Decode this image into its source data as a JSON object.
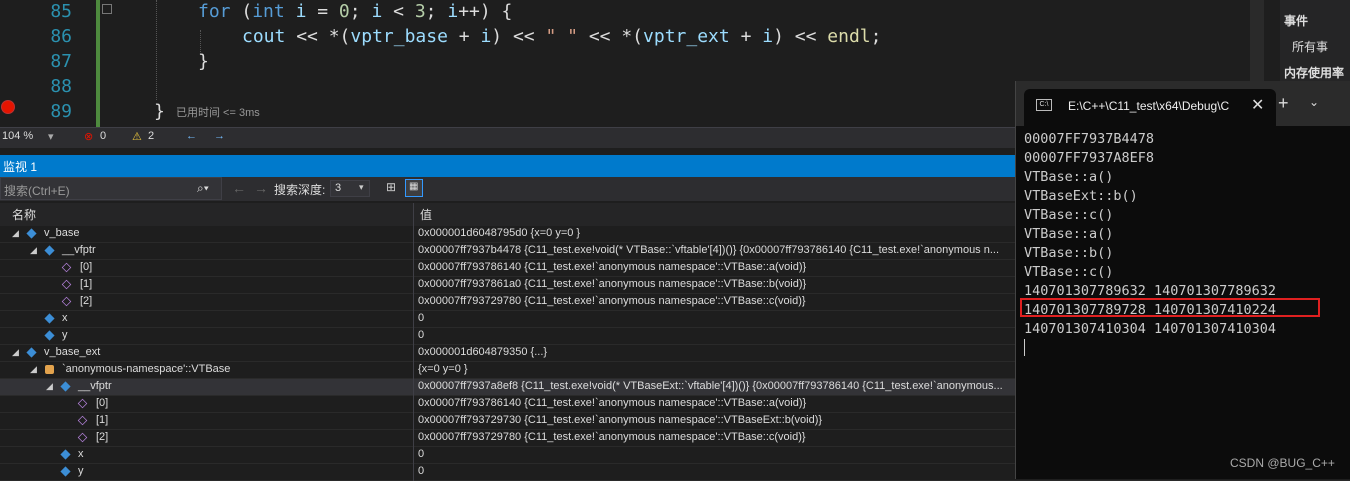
{
  "editor": {
    "line_numbers": [
      "85",
      "86",
      "87",
      "88",
      "89"
    ],
    "elapsed": "已用时间 <= 3ms"
  },
  "right_panel": {
    "events": "事件",
    "all_events": "所有事",
    "memory": "内存使用率"
  },
  "status": {
    "zoom": "104 %",
    "errors": "0",
    "warnings": "2"
  },
  "watch": {
    "title": "监视 1",
    "search_placeholder": "搜索(Ctrl+E)",
    "depth_label": "搜索深度:",
    "depth_value": "3",
    "col_name": "名称",
    "col_value": "值",
    "rows": [
      {
        "name": "v_base",
        "value": "0x000001d6048795d0 {x=0 y=0 }"
      },
      {
        "name": "__vfptr",
        "value": "0x00007ff7937b4478 {C11_test.exe!void(* VTBase::`vftable'[4])()} {0x00007ff793786140 {C11_test.exe!`anonymous n..."
      },
      {
        "name": "[0]",
        "value": "0x00007ff793786140 {C11_test.exe!`anonymous namespace'::VTBase::a(void)}"
      },
      {
        "name": "[1]",
        "value": "0x00007ff7937861a0 {C11_test.exe!`anonymous namespace'::VTBase::b(void)}"
      },
      {
        "name": "[2]",
        "value": "0x00007ff793729780 {C11_test.exe!`anonymous namespace'::VTBase::c(void)}"
      },
      {
        "name": "x",
        "value": "0"
      },
      {
        "name": "y",
        "value": "0"
      },
      {
        "name": "v_base_ext",
        "value": "0x000001d604879350 {...}"
      },
      {
        "name": "`anonymous-namespace'::VTBase",
        "value": "{x=0 y=0 }"
      },
      {
        "name": "__vfptr",
        "value": "0x00007ff7937a8ef8 {C11_test.exe!void(* VTBaseExt::`vftable'[4])()} {0x00007ff793786140 {C11_test.exe!`anonymous..."
      },
      {
        "name": "[0]",
        "value": "0x00007ff793786140 {C11_test.exe!`anonymous namespace'::VTBase::a(void)}"
      },
      {
        "name": "[1]",
        "value": "0x00007ff793729730 {C11_test.exe!`anonymous namespace'::VTBaseExt::b(void)}"
      },
      {
        "name": "[2]",
        "value": "0x00007ff793729780 {C11_test.exe!`anonymous namespace'::VTBase::c(void)}"
      },
      {
        "name": "x",
        "value": "0"
      },
      {
        "name": "y",
        "value": "0"
      }
    ]
  },
  "console": {
    "tab_title": "E:\\C++\\C11_test\\x64\\Debug\\C",
    "lines": [
      "00007FF7937B4478",
      "00007FF7937A8EF8",
      "VTBase::a()",
      "VTBaseExt::b()",
      "VTBase::c()",
      "VTBase::a()",
      "VTBase::b()",
      "VTBase::c()",
      "140701307789632 140701307789632",
      "140701307789728 140701307410224",
      "140701307410304 140701307410304"
    ],
    "watermark": "CSDN @BUG_C++"
  }
}
